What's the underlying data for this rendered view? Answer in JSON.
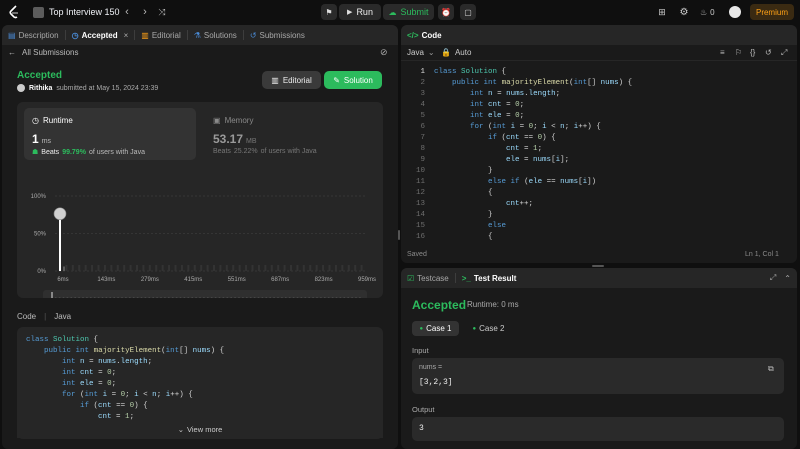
{
  "topbar": {
    "problem_list": "Top Interview 150",
    "run": "Run",
    "submit": "Submit",
    "streak": "0",
    "premium": "Premium"
  },
  "left_tabs": [
    "Description",
    "Accepted",
    "Editorial",
    "Solutions",
    "Submissions"
  ],
  "submission": {
    "back": "All Submissions",
    "status": "Accepted",
    "user": "Rithika",
    "submitted": "submitted at May 15, 2024 23:39",
    "editorial_btn": "Editorial",
    "solution_btn": "Solution",
    "runtime": {
      "label": "Runtime",
      "value": "1",
      "unit": "ms",
      "beats_label": "Beats",
      "beats": "99.79%",
      "suffix": "of users with Java"
    },
    "memory": {
      "label": "Memory",
      "value": "53.17",
      "unit": "MB",
      "beats_label": "Beats",
      "beats": "25.22%",
      "suffix": "of users with Java"
    }
  },
  "chart_data": {
    "type": "bar",
    "y_ticks": [
      "100%",
      "50%",
      "0%"
    ],
    "x_ticks": [
      "6ms",
      "143ms",
      "279ms",
      "415ms",
      "551ms",
      "687ms",
      "823ms",
      "959ms"
    ],
    "ylim": [
      0,
      100
    ],
    "bars": [
      {
        "x": "1ms",
        "value": 75,
        "highlight": true
      },
      {
        "x": "6ms",
        "value": 6,
        "highlight": false
      }
    ]
  },
  "left_code": {
    "label": "Code",
    "lang": "Java",
    "lines": [
      "class Solution {",
      "    public int majorityElement(int[] nums) {",
      "        int n = nums.length;",
      "        int cnt = 0;",
      "        int ele = 0;",
      "        for (int i = 0; i < n; i++) {",
      "            if (cnt == 0) {",
      "                cnt = 1;"
    ],
    "view_more": "View more"
  },
  "editor": {
    "title": "Code",
    "lang": "Java",
    "mode": "Auto",
    "lines": [
      "class Solution {",
      "    public int majorityElement(int[] nums) {",
      "        int n = nums.length;",
      "        int cnt = 0;",
      "        int ele = 0;",
      "        for (int i = 0; i < n; i++) {",
      "            if (cnt == 0) {",
      "                cnt = 1;",
      "                ele = nums[i];",
      "            }",
      "            else if (ele == nums[i])",
      "            {",
      "                cnt++;",
      "            }",
      "            else",
      "            {"
    ],
    "status": "Saved",
    "cursor": "Ln 1, Col 1"
  },
  "console": {
    "tab_testcase": "Testcase",
    "tab_result": "Test Result",
    "status": "Accepted",
    "runtime": "Runtime: 0 ms",
    "cases": [
      "Case 1",
      "Case 2"
    ],
    "input_label": "Input",
    "var_name": "nums =",
    "var_value": "[3,2,3]",
    "output_label": "Output",
    "output_value": "3"
  },
  "colors": {
    "accent_green": "#2cbb5d",
    "premium": "#ffa116",
    "bar_white": "#ffffff"
  }
}
